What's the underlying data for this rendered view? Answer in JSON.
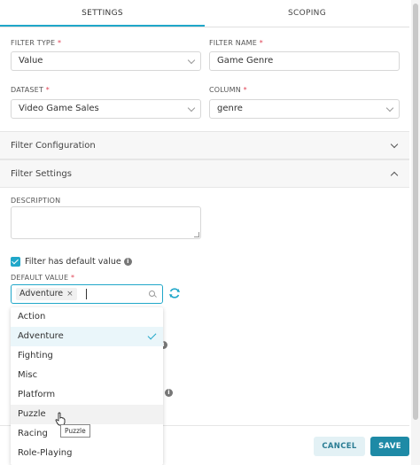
{
  "tabs": [
    {
      "label": "SETTINGS",
      "active": true
    },
    {
      "label": "SCOPING",
      "active": false
    }
  ],
  "fields": {
    "filter_type": {
      "label": "FILTER TYPE",
      "value": "Value"
    },
    "filter_name": {
      "label": "FILTER NAME",
      "value": "Game Genre"
    },
    "dataset": {
      "label": "DATASET",
      "value": "Video Game Sales"
    },
    "column": {
      "label": "COLUMN",
      "value": "genre"
    },
    "required_mark": "*"
  },
  "sections": {
    "filter_configuration": {
      "label": "Filter Configuration",
      "expanded": false
    },
    "filter_settings": {
      "label": "Filter Settings",
      "expanded": true
    }
  },
  "description": {
    "label": "DESCRIPTION",
    "value": ""
  },
  "default_value": {
    "checkbox_label": "Filter has default value",
    "checked": true,
    "label": "DEFAULT VALUE",
    "chip": "Adventure",
    "chip_remove": "×"
  },
  "dropdown": {
    "options": [
      "Action",
      "Adventure",
      "Fighting",
      "Misc",
      "Platform",
      "Puzzle",
      "Racing",
      "Role-Playing"
    ],
    "selected_index": 1,
    "hover_index": 5,
    "tooltip": "Puzzle"
  },
  "footer": {
    "cancel_label": "CANCEL",
    "save_label": "SAVE"
  },
  "colors": {
    "accent": "#20a7c9",
    "save": "#1e8aa6",
    "required": "#e04355"
  },
  "icons": {
    "info": "i"
  }
}
